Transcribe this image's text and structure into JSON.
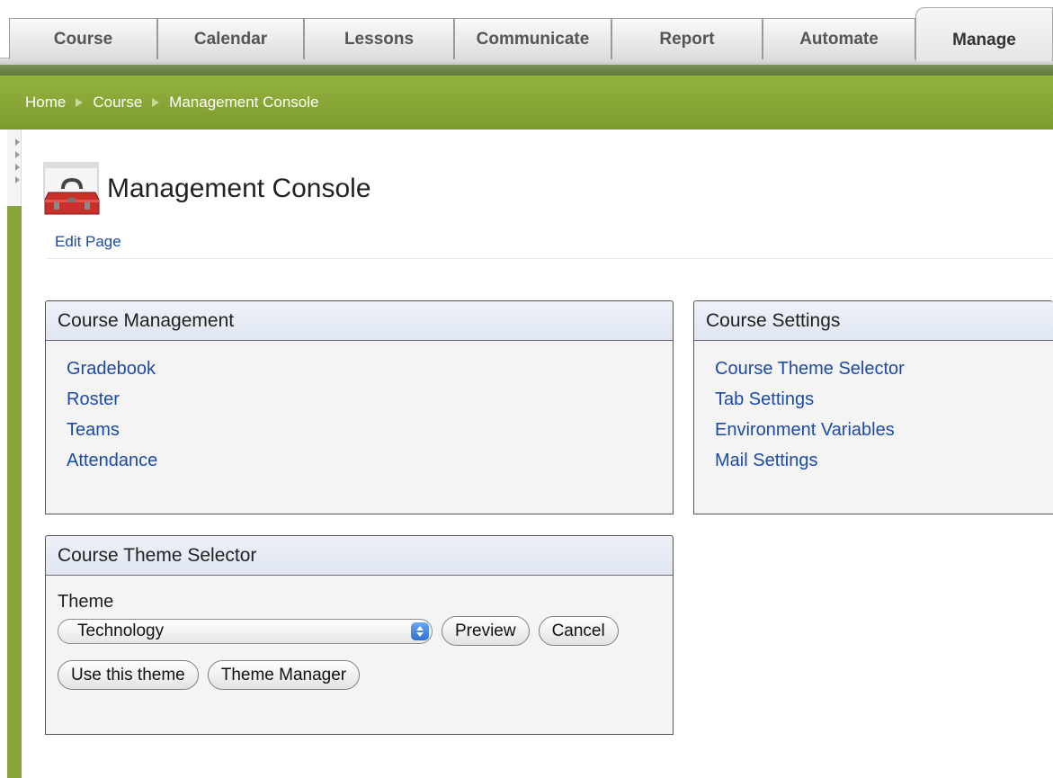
{
  "tabs": [
    {
      "label": "Course",
      "active": false
    },
    {
      "label": "Calendar",
      "active": false
    },
    {
      "label": "Lessons",
      "active": false
    },
    {
      "label": "Communicate",
      "active": false
    },
    {
      "label": "Report",
      "active": false
    },
    {
      "label": "Automate",
      "active": false
    },
    {
      "label": "Manage",
      "active": true
    }
  ],
  "breadcrumb": [
    "Home",
    "Course",
    "Management Console"
  ],
  "page": {
    "title": "Management Console",
    "edit_link": "Edit Page",
    "icon": "toolbox-icon"
  },
  "course_management": {
    "title": "Course Management",
    "links": [
      "Gradebook",
      "Roster",
      "Teams",
      "Attendance"
    ]
  },
  "course_settings": {
    "title": "Course Settings",
    "links": [
      "Course Theme Selector",
      "Tab Settings",
      "Environment Variables",
      "Mail Settings"
    ]
  },
  "theme_selector": {
    "title": "Course Theme Selector",
    "field_label": "Theme",
    "selected": "Technology",
    "preview_label": "Preview",
    "cancel_label": "Cancel",
    "use_label": "Use this theme",
    "manager_label": "Theme Manager"
  },
  "colors": {
    "brand_green": "#86a63b",
    "link_blue": "#1c4aa8",
    "panel_header": "#dfe6f2"
  }
}
